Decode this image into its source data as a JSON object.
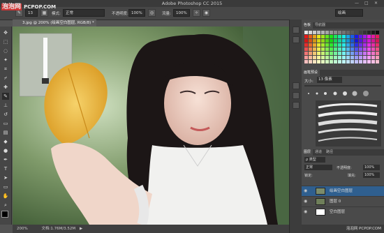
{
  "window": {
    "title": "Adobe Photoshop CC 2015",
    "min": "—",
    "max": "□",
    "close": "✕"
  },
  "watermark": {
    "brand": "泡泡网",
    "site": "PCPOP.COM"
  },
  "options": {
    "brush_size": "13",
    "mode_label": "模式:",
    "mode_value": "正常",
    "opacity_label": "不透明度:",
    "opacity_value": "100%",
    "flow_label": "流量:",
    "flow_value": "100%",
    "workspace": "绘画"
  },
  "document": {
    "tab_title": "3.jpg @ 200% (绘画空白图层, RGB/8) *",
    "close": "×"
  },
  "status": {
    "zoom": "200%",
    "doc_size": "文档:1.76M/3.52M",
    "arrow": "▶"
  },
  "panels": {
    "swatches_tabs": [
      "色板",
      "导航器"
    ],
    "brush_tabs": [
      "画笔预设"
    ],
    "brush_size_label": "大小:",
    "brush_size_value": "13 像素",
    "layers_tabs": [
      "图层",
      "通道",
      "路径"
    ],
    "kind_label": "ρ 类型",
    "blend_mode": "正常",
    "opacity_label": "不透明度:",
    "opacity_value": "100%",
    "lock_label": "锁定:",
    "fill_label": "填充:",
    "fill_value": "100%",
    "layers": [
      {
        "name": "绘画空白图层",
        "selected": true
      },
      {
        "name": "图层 0",
        "selected": false
      },
      {
        "name": "空白图层",
        "selected": false
      }
    ],
    "footer_watermark": "泡泡网 PCPOP.COM"
  },
  "colors": {
    "accent": "#2f5f8f",
    "panel_bg": "#4a4a4a",
    "dark": "#2b2b2b"
  }
}
